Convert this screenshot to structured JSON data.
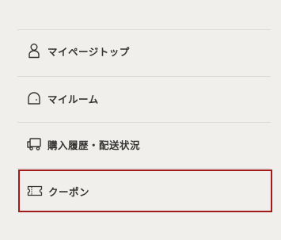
{
  "menu": {
    "items": [
      {
        "label": "マイページトップ",
        "icon": "person-icon"
      },
      {
        "label": "マイルーム",
        "icon": "room-icon"
      },
      {
        "label": "購入履歴・配送状況",
        "icon": "delivery-truck-icon"
      },
      {
        "label": "クーポン",
        "icon": "coupon-ticket-icon"
      }
    ]
  },
  "colors": {
    "background": "#f0efeb",
    "divider": "#dcdad5",
    "text": "#333333",
    "highlight_border": "#a31a1a"
  }
}
